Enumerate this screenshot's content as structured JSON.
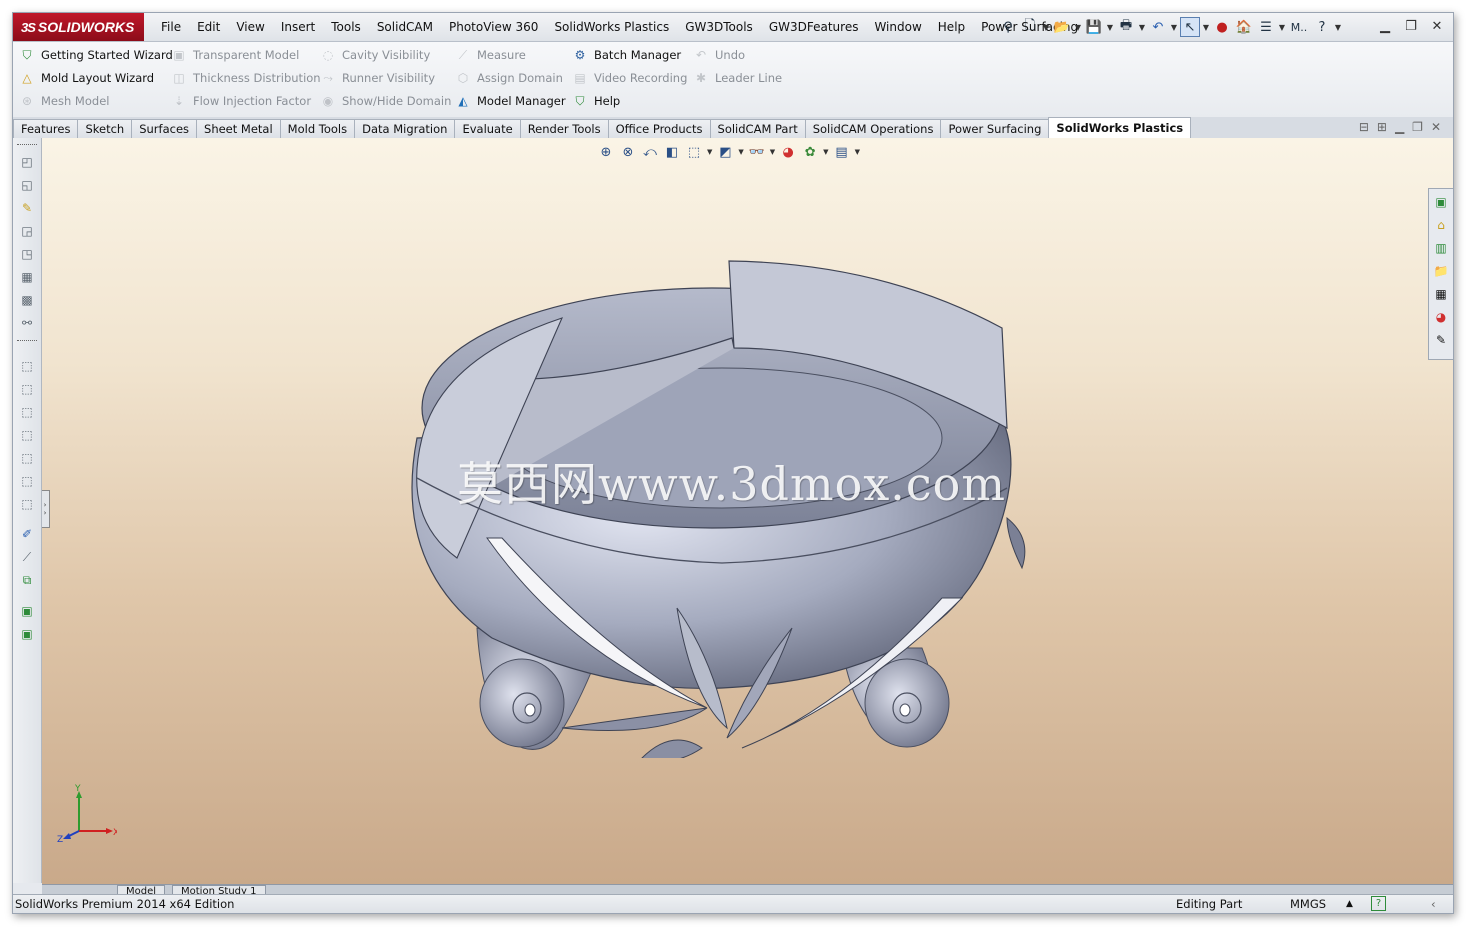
{
  "app": {
    "logo_text": "SOLIDWORKS",
    "logo_prefix": "3S"
  },
  "menu": [
    "File",
    "Edit",
    "View",
    "Insert",
    "Tools",
    "SolidCAM",
    "PhotoView 360",
    "SolidWorks Plastics",
    "GW3DTools",
    "GW3DFeatures",
    "Window",
    "Help",
    "Power Surfacing"
  ],
  "quick_access": {
    "search_label": "M.."
  },
  "commands": {
    "getting_started": "Getting Started Wizard",
    "mold_layout": "Mold Layout Wizard",
    "mesh_model": "Mesh Model",
    "transparent_model": "Transparent Model",
    "thickness_distribution": "Thickness Distribution",
    "flow_injection": "Flow Injection Factor",
    "cavity_visibility": "Cavity Visibility",
    "runner_visibility": "Runner Visibility",
    "show_hide_domain": "Show/Hide Domain",
    "measure": "Measure",
    "assign_domain": "Assign Domain",
    "model_manager": "Model Manager",
    "batch_manager": "Batch Manager",
    "video_recording": "Video Recording",
    "help": "Help",
    "undo": "Undo",
    "leader_line": "Leader Line"
  },
  "tabs": [
    "Features",
    "Sketch",
    "Surfaces",
    "Sheet Metal",
    "Mold Tools",
    "Data Migration",
    "Evaluate",
    "Render Tools",
    "Office Products",
    "SolidCAM Part",
    "SolidCAM Operations",
    "Power Surfacing",
    "SolidWorks Plastics"
  ],
  "active_tab": "SolidWorks Plastics",
  "viewport": {
    "watermark": "莫西网www.3dmox.com",
    "triad": {
      "x": "X",
      "y": "Y",
      "z": "Z"
    }
  },
  "model_tabs": [
    "Model",
    "Motion Study 1"
  ],
  "status": {
    "edition": "SolidWorks Premium 2014 x64 Edition",
    "mode": "Editing Part",
    "units": "MMGS"
  },
  "colors": {
    "logo_red": "#b01020",
    "accent_blue": "#2a4f86",
    "bowl_gray": "#9aa0b4"
  }
}
